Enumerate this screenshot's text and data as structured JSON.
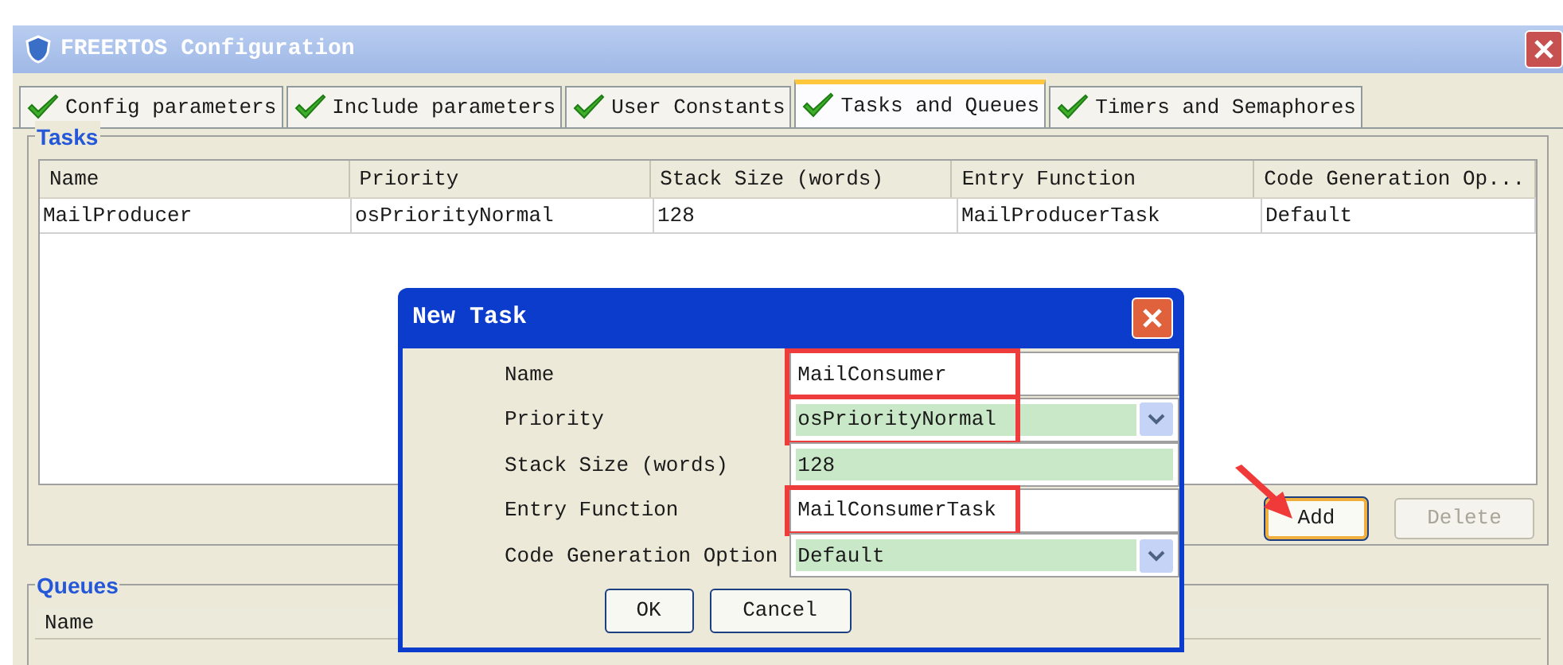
{
  "window": {
    "title": "FREERTOS Configuration"
  },
  "tabs": [
    {
      "label": "Config parameters",
      "selected": false,
      "checked": true
    },
    {
      "label": "Include parameters",
      "selected": false,
      "checked": true
    },
    {
      "label": "User Constants",
      "selected": false,
      "checked": true
    },
    {
      "label": "Tasks and Queues",
      "selected": true,
      "checked": true
    },
    {
      "label": "Timers and Semaphores",
      "selected": false,
      "checked": true
    }
  ],
  "tasks": {
    "title": "Tasks",
    "columns": [
      "Name",
      "Priority",
      "Stack Size (words)",
      "Entry Function",
      "Code Generation Op..."
    ],
    "rows": [
      [
        "MailProducer",
        "osPriorityNormal",
        "128",
        "MailProducerTask",
        "Default"
      ]
    ]
  },
  "task_buttons": [
    {
      "label": "Add",
      "focused": true,
      "disabled": false
    },
    {
      "label": "Delete",
      "focused": false,
      "disabled": true
    }
  ],
  "queues": {
    "title": "Queues",
    "columns": [
      "Name"
    ]
  },
  "dialog": {
    "title": "New Task",
    "fields": [
      {
        "label": "Name",
        "value": "MailConsumer",
        "kind": "text",
        "default_value": false,
        "highlighted": true
      },
      {
        "label": "Priority",
        "value": "osPriorityNormal",
        "kind": "combo",
        "default_value": true,
        "highlighted": true
      },
      {
        "label": "Stack Size (words)",
        "value": "128",
        "kind": "text",
        "default_value": true,
        "highlighted": false
      },
      {
        "label": "Entry Function",
        "value": "MailConsumerTask",
        "kind": "text",
        "default_value": false,
        "highlighted": true
      },
      {
        "label": "Code Generation Option",
        "value": "Default",
        "kind": "combo",
        "default_value": true,
        "highlighted": false
      }
    ],
    "buttons": [
      "OK",
      "Cancel"
    ]
  }
}
